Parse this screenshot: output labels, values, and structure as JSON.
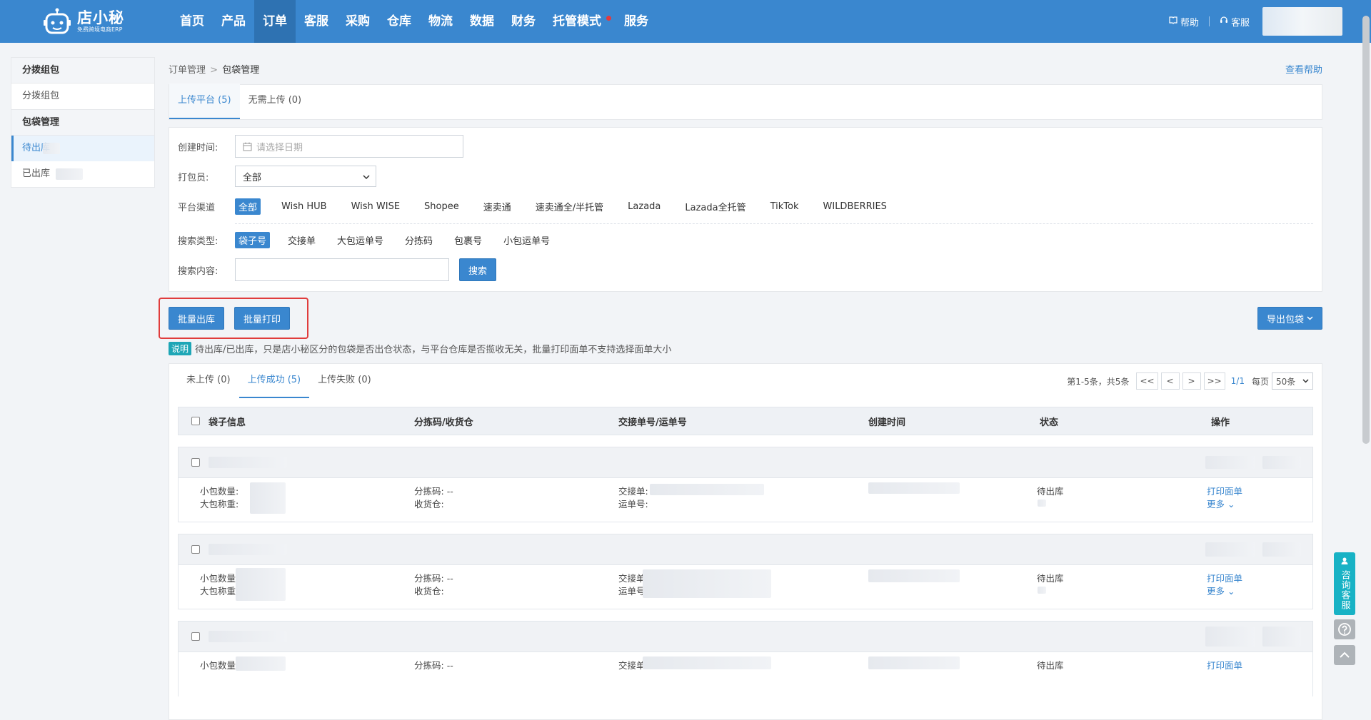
{
  "header": {
    "logo_title": "店小秘",
    "logo_sub": "免费跨境电商ERP",
    "nav": [
      {
        "label": "首页"
      },
      {
        "label": "产品"
      },
      {
        "label": "订单"
      },
      {
        "label": "客服"
      },
      {
        "label": "采购"
      },
      {
        "label": "仓库"
      },
      {
        "label": "物流"
      },
      {
        "label": "数据"
      },
      {
        "label": "财务"
      },
      {
        "label": "托管模式"
      },
      {
        "label": "服务"
      }
    ],
    "help_label": "帮助",
    "service_label": "客服"
  },
  "sidebar": {
    "group1_title": "分拨组包",
    "group1_items": [
      "分拨组包"
    ],
    "group2_title": "包袋管理",
    "group2_items": [
      "待出库",
      "已出库"
    ]
  },
  "breadcrumb": {
    "parent": "订单管理",
    "sep": ">",
    "current": "包袋管理"
  },
  "help_link": "查看帮助",
  "tabs": [
    "上传平台 (5)",
    "无需上传 (0)"
  ],
  "filters": {
    "created_label": "创建时间:",
    "date_placeholder": "请选择日期",
    "packer_label": "打包员:",
    "packer_value": "全部",
    "channel_label": "平台渠道",
    "channels": [
      "全部",
      "Wish HUB",
      "Wish WISE",
      "Shopee",
      "速卖通",
      "速卖通全/半托管",
      "Lazada",
      "Lazada全托管",
      "TikTok",
      "WILDBERRIES"
    ],
    "search_type_label": "搜索类型:",
    "search_types": [
      "袋子号",
      "交接单",
      "大包运单号",
      "分拣码",
      "包裹号",
      "小包运单号"
    ],
    "search_content_label": "搜索内容:",
    "search_button": "搜索"
  },
  "actions": {
    "batch_out": "批量出库",
    "batch_print": "批量打印",
    "export": "导出包袋"
  },
  "note": {
    "tag": "说明",
    "text": "待出库/已出库，只是店小秘区分的包袋是否出仓状态，与平台仓库是否揽收无关，批量打印面单不支持选择面单大小"
  },
  "subtabs": [
    "未上传 (0)",
    "上传成功 (5)",
    "上传失败 (0)"
  ],
  "pager": {
    "summary": "第1-5条，共5条",
    "first": "<<",
    "prev": "<",
    "next": ">",
    "last": ">>",
    "page": "1/1",
    "per_page_label": "每页",
    "per_page_value": "50条"
  },
  "table": {
    "headers": [
      "袋子信息",
      "分拣码/收货仓",
      "交接单号/运单号",
      "创建时间",
      "状态",
      "操作"
    ],
    "rows": [
      {
        "small_count_label": "小包数量:",
        "big_weight_label": "大包称重:",
        "sort_code_label": "分拣码:",
        "sort_code_value": "--",
        "warehouse_label": "收货仓:",
        "handover_label": "交接单:",
        "tracking_label": "运单号:",
        "status": "待出库",
        "print": "打印面单",
        "more": "更多"
      },
      {
        "small_count_label": "小包数量",
        "big_weight_label": "大包称重",
        "sort_code_label": "分拣码:",
        "sort_code_value": "--",
        "warehouse_label": "收货仓:",
        "handover_label": "交接单",
        "tracking_label": "运单号:",
        "status": "待出库",
        "print": "打印面单",
        "more": "更多"
      },
      {
        "small_count_label": "小包数量",
        "big_weight_label": "",
        "sort_code_label": "分拣码:",
        "sort_code_value": "--",
        "warehouse_label": "",
        "handover_label": "交接单",
        "tracking_label": "",
        "status": "待出库",
        "print": "打印面单",
        "more": ""
      }
    ]
  },
  "float": {
    "consult": "咨询客服"
  }
}
